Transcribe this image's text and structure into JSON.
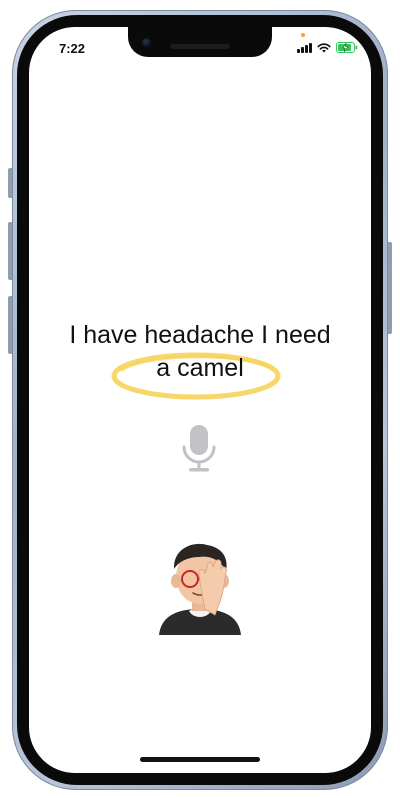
{
  "status_bar": {
    "time": "7:22",
    "privacy_indicator_color": "#f5a623",
    "icons": [
      "cellular-signal-icon",
      "wifi-icon",
      "battery-charging-icon"
    ],
    "battery_color": "#34c759"
  },
  "transcript": {
    "line1": "I have headache I need",
    "line2": "a camel",
    "highlight_color": "#f7d35a"
  },
  "microphone": {
    "icon": "microphone-icon",
    "color": "#c2c2c6"
  },
  "avatar": {
    "icon": "memoji-facepalm-icon"
  }
}
